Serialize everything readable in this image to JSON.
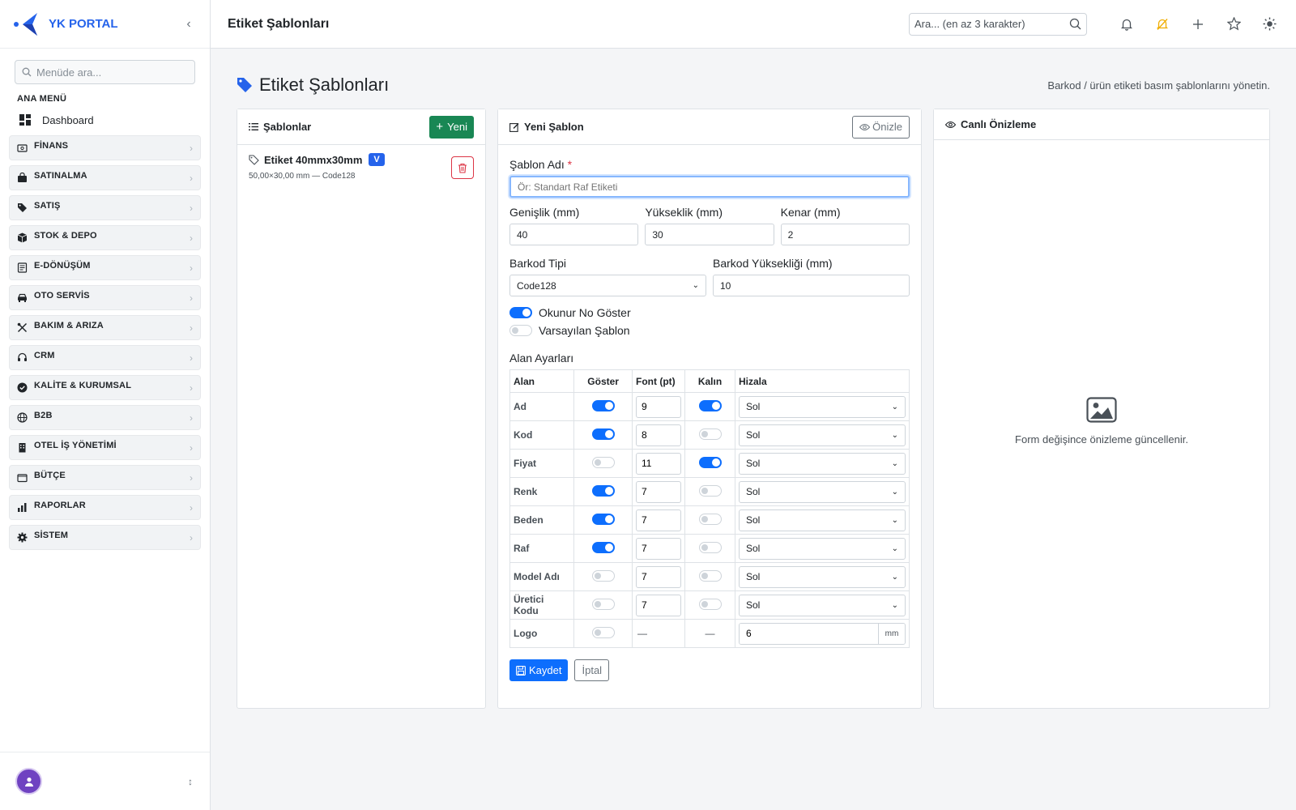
{
  "brand": {
    "name": "YK PORTAL"
  },
  "sidebar": {
    "search_placeholder": "Menüde ara...",
    "heading": "ANA MENÜ",
    "dashboard": "Dashboard",
    "items": [
      {
        "label": "FİNANS",
        "icon": "finance-icon"
      },
      {
        "label": "SATINALMA",
        "icon": "bag-icon"
      },
      {
        "label": "SATIŞ",
        "icon": "tag-icon"
      },
      {
        "label": "STOK & DEPO",
        "icon": "box-icon"
      },
      {
        "label": "E-DÖNÜŞÜM",
        "icon": "document-icon"
      },
      {
        "label": "OTO SERVİS",
        "icon": "car-icon"
      },
      {
        "label": "BAKIM & ARIZA",
        "icon": "tools-icon"
      },
      {
        "label": "CRM",
        "icon": "headset-icon"
      },
      {
        "label": "KALİTE & KURUMSAL",
        "icon": "shield-check-icon"
      },
      {
        "label": "B2B",
        "icon": "globe-icon"
      },
      {
        "label": "OTEL İŞ YÖNETİMİ",
        "icon": "building-icon"
      },
      {
        "label": "BÜTÇE",
        "icon": "wallet-icon"
      },
      {
        "label": "RAPORLAR",
        "icon": "bar-chart-icon"
      },
      {
        "label": "SİSTEM",
        "icon": "gear-icon"
      }
    ]
  },
  "topbar": {
    "title": "Etiket Şablonları",
    "search_placeholder": "Ara... (en az 3 karakter)"
  },
  "page": {
    "title": "Etiket Şablonları",
    "subtitle": "Barkod / ürün etiketi basım şablonlarını yönetin."
  },
  "templates": {
    "header": "Şablonlar",
    "new_button": "Yeni",
    "items": [
      {
        "name": "Etiket 40mmx30mm",
        "badge": "V",
        "meta": "50,00×30,00 mm — Code128"
      }
    ]
  },
  "form": {
    "header": "Yeni Şablon",
    "preview_button": "Önizle",
    "name_label": "Şablon Adı",
    "required_mark": "*",
    "name_placeholder": "Ör: Standart Raf Etiketi",
    "width_label": "Genişlik (mm)",
    "width_value": "40",
    "height_label": "Yükseklik (mm)",
    "height_value": "30",
    "margin_label": "Kenar (mm)",
    "margin_value": "2",
    "barcode_type_label": "Barkod Tipi",
    "barcode_type_value": "Code128",
    "barcode_height_label": "Barkod Yüksekliği (mm)",
    "barcode_height_value": "10",
    "show_readable_label": "Okunur No Göster",
    "show_readable_on": true,
    "default_template_label": "Varsayılan Şablon",
    "default_template_on": false,
    "fields_title": "Alan Ayarları",
    "columns": [
      "Alan",
      "Göster",
      "Font (pt)",
      "Kalın",
      "Hizala"
    ],
    "rows": [
      {
        "name": "Ad",
        "show": true,
        "font": "9",
        "bold": true,
        "align": "Sol"
      },
      {
        "name": "Kod",
        "show": true,
        "font": "8",
        "bold": false,
        "align": "Sol"
      },
      {
        "name": "Fiyat",
        "show": false,
        "font": "11",
        "bold": true,
        "align": "Sol"
      },
      {
        "name": "Renk",
        "show": true,
        "font": "7",
        "bold": false,
        "align": "Sol"
      },
      {
        "name": "Beden",
        "show": true,
        "font": "7",
        "bold": false,
        "align": "Sol"
      },
      {
        "name": "Raf",
        "show": true,
        "font": "7",
        "bold": false,
        "align": "Sol"
      },
      {
        "name": "Model Adı",
        "show": false,
        "font": "7",
        "bold": false,
        "align": "Sol"
      },
      {
        "name": "Üretici Kodu",
        "show": false,
        "font": "7",
        "bold": false,
        "align": "Sol"
      }
    ],
    "logo_row": {
      "name": "Logo",
      "show": false,
      "font": "—",
      "bold": "—",
      "size": "6",
      "unit": "mm"
    },
    "save_button": "Kaydet",
    "cancel_button": "İptal"
  },
  "preview": {
    "header": "Canlı Önizleme",
    "empty_message": "Form değişince önizleme güncellenir."
  },
  "colors": {
    "accent": "#0d6efd",
    "brand": "#2563eb",
    "success": "#198754",
    "danger": "#dc3545",
    "bell_warning": "#f0ad00"
  }
}
